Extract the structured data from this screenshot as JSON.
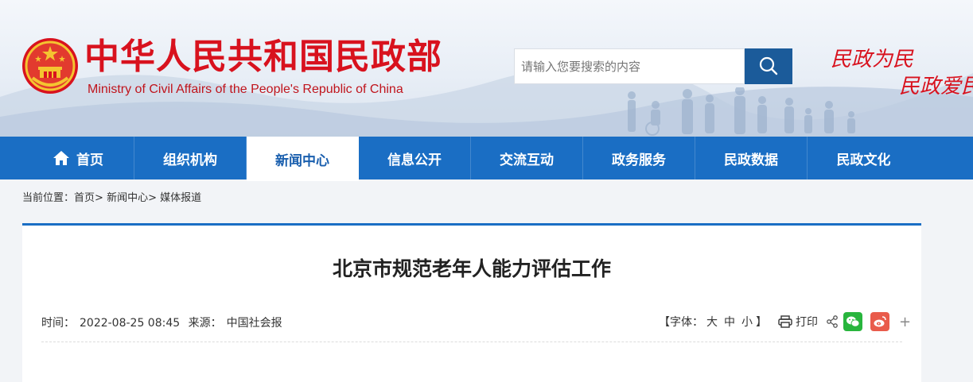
{
  "header": {
    "site_title": "中华人民共和国民政部",
    "site_subtitle": "Ministry of Civil Affairs of the People's Republic of China",
    "search_placeholder": "请输入您要搜索的内容",
    "slogan_line1": "民政为民",
    "slogan_line2": "民政爱民",
    "colors": {
      "brand_red": "#d8121e",
      "nav_blue": "#1a6ec4",
      "search_blue": "#1b5b9a"
    }
  },
  "nav": {
    "items": [
      {
        "label": "首页",
        "icon": "home-icon"
      },
      {
        "label": "组织机构"
      },
      {
        "label": "新闻中心",
        "active": true
      },
      {
        "label": "信息公开"
      },
      {
        "label": "交流互动"
      },
      {
        "label": "政务服务"
      },
      {
        "label": "民政数据"
      },
      {
        "label": "民政文化"
      }
    ]
  },
  "breadcrumb": {
    "prefix": "当前位置：",
    "items": [
      "首页",
      "新闻中心",
      "媒体报道"
    ],
    "separator": ">"
  },
  "article": {
    "title": "北京市规范老年人能力评估工作",
    "time_label": "时间：",
    "time": "2022-08-25 08:45",
    "source_label": "来源：",
    "source": "中国社会报",
    "font_size_open": "【字体：",
    "font_large": "大",
    "font_medium": "中",
    "font_small": "小",
    "font_size_close": "】",
    "print_label": "打印",
    "more": "+"
  }
}
